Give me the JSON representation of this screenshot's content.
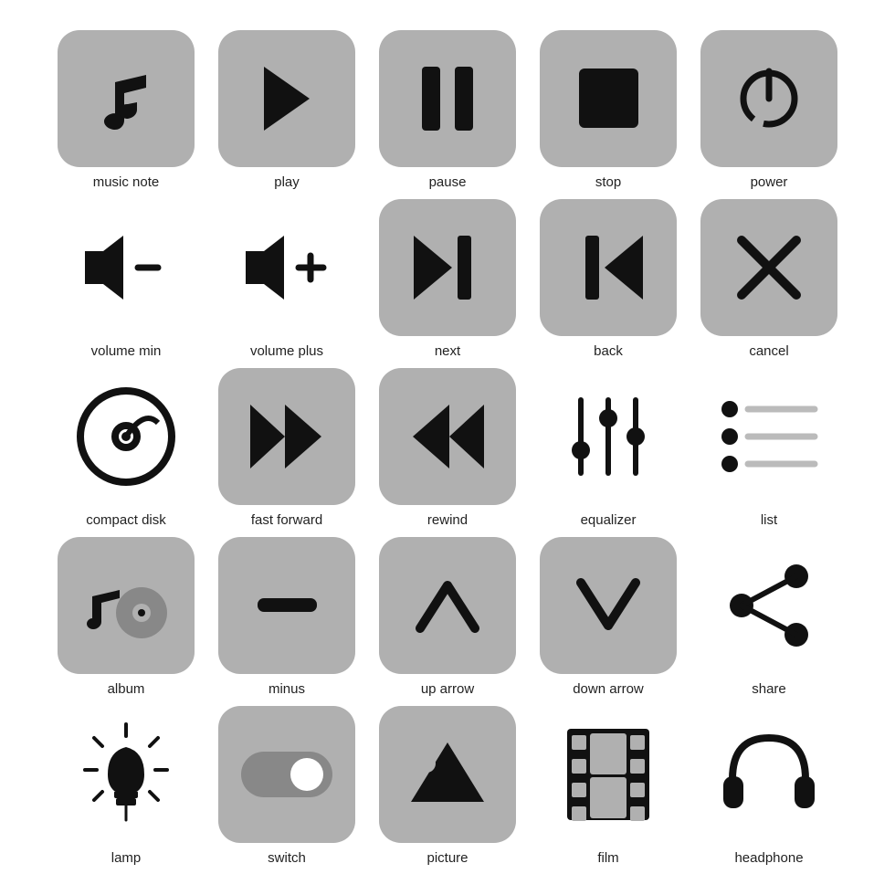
{
  "icons": [
    {
      "name": "music-note-icon",
      "label": "music note"
    },
    {
      "name": "play-icon",
      "label": "play"
    },
    {
      "name": "pause-icon",
      "label": "pause"
    },
    {
      "name": "stop-icon",
      "label": "stop"
    },
    {
      "name": "power-icon",
      "label": "power"
    },
    {
      "name": "volume-min-icon",
      "label": "volume min"
    },
    {
      "name": "volume-plus-icon",
      "label": "volume plus"
    },
    {
      "name": "next-icon",
      "label": "next"
    },
    {
      "name": "back-icon",
      "label": "back"
    },
    {
      "name": "cancel-icon",
      "label": "cancel"
    },
    {
      "name": "compact-disk-icon",
      "label": "compact disk"
    },
    {
      "name": "fast-forward-icon",
      "label": "fast forward"
    },
    {
      "name": "rewind-icon",
      "label": "rewind"
    },
    {
      "name": "equalizer-icon",
      "label": "equalizer"
    },
    {
      "name": "list-icon",
      "label": "list"
    },
    {
      "name": "album-icon",
      "label": "album"
    },
    {
      "name": "minus-icon",
      "label": "minus"
    },
    {
      "name": "up-arrow-icon",
      "label": "up arrow"
    },
    {
      "name": "down-arrow-icon",
      "label": "down arrow"
    },
    {
      "name": "share-icon",
      "label": "share"
    },
    {
      "name": "lamp-icon",
      "label": "lamp"
    },
    {
      "name": "switch-icon",
      "label": "switch"
    },
    {
      "name": "picture-icon",
      "label": "picture"
    },
    {
      "name": "film-icon",
      "label": "film"
    },
    {
      "name": "headphone-icon",
      "label": "headphone"
    }
  ]
}
